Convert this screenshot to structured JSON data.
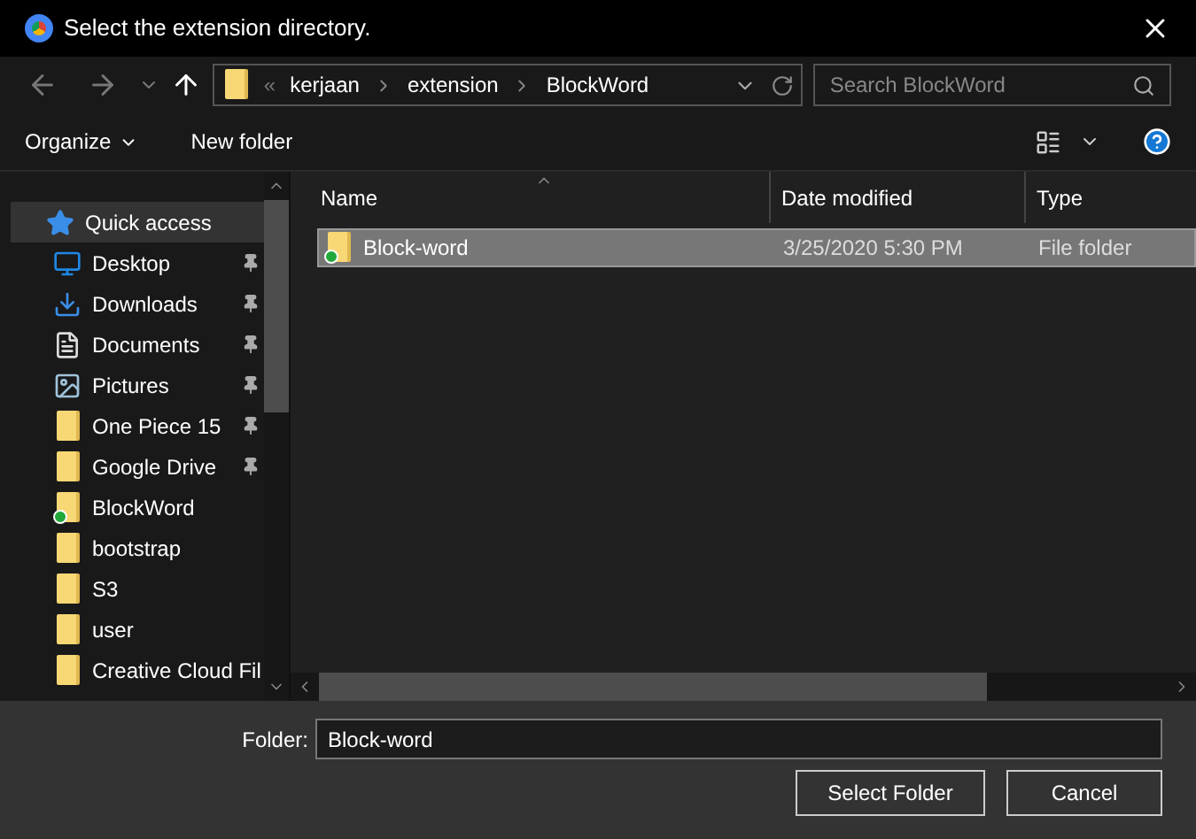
{
  "window": {
    "title": "Select the extension directory."
  },
  "address_bar": {
    "overflow": "«",
    "crumbs": [
      "kerjaan",
      "extension",
      "BlockWord"
    ]
  },
  "search": {
    "placeholder": "Search BlockWord"
  },
  "toolbar": {
    "organize": "Organize",
    "new_folder": "New folder"
  },
  "sidebar": {
    "items": [
      {
        "label": "Quick access",
        "kind": "star",
        "pinned": false,
        "selected": true,
        "synced": false
      },
      {
        "label": "Desktop",
        "kind": "desktop",
        "pinned": true,
        "selected": false,
        "synced": false
      },
      {
        "label": "Downloads",
        "kind": "download",
        "pinned": true,
        "selected": false,
        "synced": false
      },
      {
        "label": "Documents",
        "kind": "document",
        "pinned": true,
        "selected": false,
        "synced": false
      },
      {
        "label": "Pictures",
        "kind": "picture",
        "pinned": true,
        "selected": false,
        "synced": false
      },
      {
        "label": "One Piece 15",
        "kind": "folder",
        "pinned": true,
        "selected": false,
        "synced": false
      },
      {
        "label": "Google Drive",
        "kind": "folder",
        "pinned": true,
        "selected": false,
        "synced": false
      },
      {
        "label": "BlockWord",
        "kind": "folder",
        "pinned": false,
        "selected": false,
        "synced": true
      },
      {
        "label": "bootstrap",
        "kind": "folder",
        "pinned": false,
        "selected": false,
        "synced": false
      },
      {
        "label": "S3",
        "kind": "folder",
        "pinned": false,
        "selected": false,
        "synced": false
      },
      {
        "label": "user",
        "kind": "folder",
        "pinned": false,
        "selected": false,
        "synced": false
      },
      {
        "label": "Creative Cloud Fil",
        "kind": "folder",
        "pinned": false,
        "selected": false,
        "synced": false
      }
    ]
  },
  "table": {
    "columns": [
      "Name",
      "Date modified",
      "Type"
    ],
    "rows": [
      {
        "name": "Block-word",
        "date": "3/25/2020 5:30 PM",
        "type": "File folder",
        "selected": true,
        "synced": true
      }
    ]
  },
  "footer": {
    "folder_label": "Folder:",
    "folder_value": "Block-word",
    "buttons": [
      "Select Folder",
      "Cancel"
    ]
  }
}
